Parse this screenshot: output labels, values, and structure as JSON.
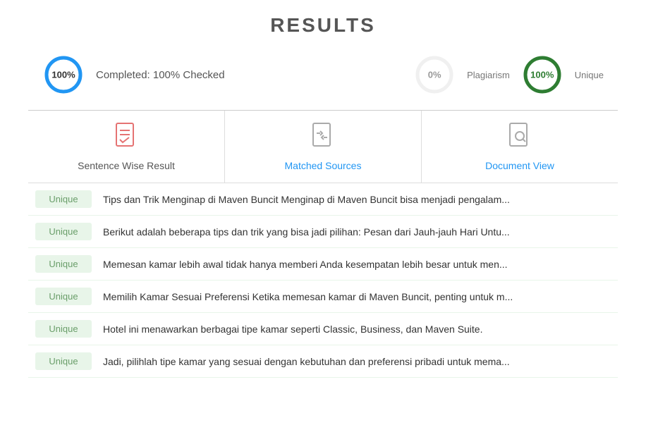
{
  "title": "RESULTS",
  "stats": {
    "left": {
      "percent": "100%",
      "label": "Completed: 100% Checked",
      "circle_color": "#2196f3",
      "circle_bg": "#e3f0fc"
    },
    "middle": {
      "percent": "0%",
      "label": "Plagiarism",
      "circle_color": "#ccc",
      "circle_bg": "#f0f0f0"
    },
    "right": {
      "percent": "100%",
      "label": "Unique",
      "circle_color": "#2e7d32",
      "circle_bg": "#e8f5e9"
    }
  },
  "tabs": [
    {
      "id": "sentence-wise",
      "label": "Sentence Wise Result",
      "icon_type": "doc-check",
      "active": false
    },
    {
      "id": "matched-sources",
      "label": "Matched Sources",
      "icon_type": "doc-arrows",
      "active": true
    },
    {
      "id": "document-view",
      "label": "Document View",
      "icon_type": "doc-search",
      "active": true
    }
  ],
  "results": [
    {
      "badge": "Unique",
      "text": "Tips dan Trik Menginap di Maven Buncit Menginap di Maven Buncit bisa menjadi pengalam..."
    },
    {
      "badge": "Unique",
      "text": "Berikut adalah beberapa tips dan trik yang bisa jadi pilihan: Pesan dari Jauh-jauh Hari Untu..."
    },
    {
      "badge": "Unique",
      "text": "Memesan kamar lebih awal tidak hanya memberi Anda kesempatan lebih besar untuk men..."
    },
    {
      "badge": "Unique",
      "text": "Memilih Kamar Sesuai Preferensi Ketika memesan kamar di Maven Buncit, penting untuk m..."
    },
    {
      "badge": "Unique",
      "text": "Hotel ini menawarkan berbagai tipe kamar seperti Classic, Business, dan Maven Suite."
    },
    {
      "badge": "Unique",
      "text": "Jadi, pilihlah tipe kamar yang sesuai dengan kebutuhan dan preferensi pribadi untuk mema..."
    }
  ]
}
